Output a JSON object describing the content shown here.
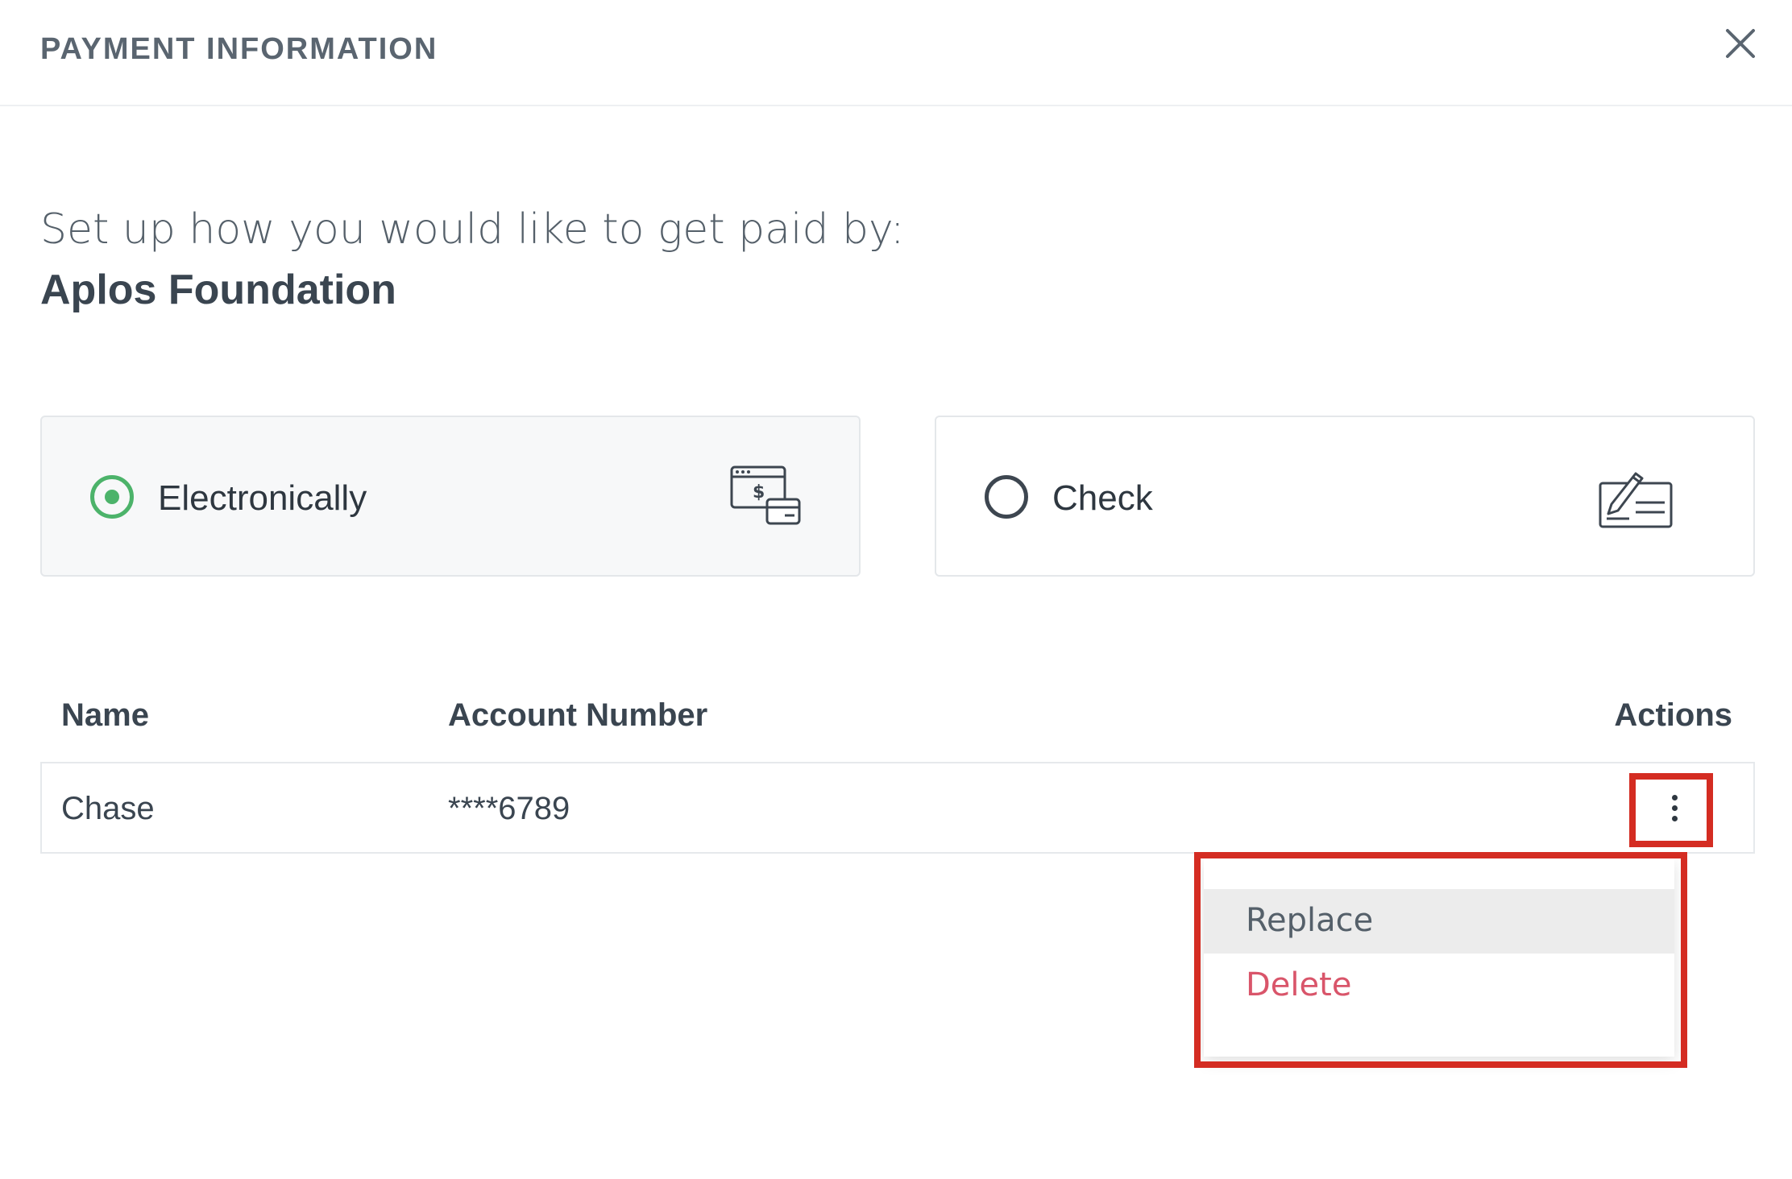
{
  "header": {
    "title": "PAYMENT INFORMATION"
  },
  "intro": {
    "text": "Set up how you would like to get paid by:",
    "organization": "Aplos Foundation"
  },
  "options": [
    {
      "label": "Electronically",
      "selected": true,
      "icon": "electronic-payment-icon"
    },
    {
      "label": "Check",
      "selected": false,
      "icon": "check-writing-icon"
    }
  ],
  "accent_color": "#4cb36a",
  "highlight_color": "#d42c22",
  "table": {
    "headers": {
      "name": "Name",
      "account": "Account Number",
      "actions": "Actions"
    },
    "rows": [
      {
        "name": "Chase",
        "account": "****6789"
      }
    ]
  },
  "actions_menu": {
    "items": [
      {
        "label": "Replace",
        "color": "#55606a"
      },
      {
        "label": "Delete",
        "color": "#d9556a"
      }
    ]
  }
}
